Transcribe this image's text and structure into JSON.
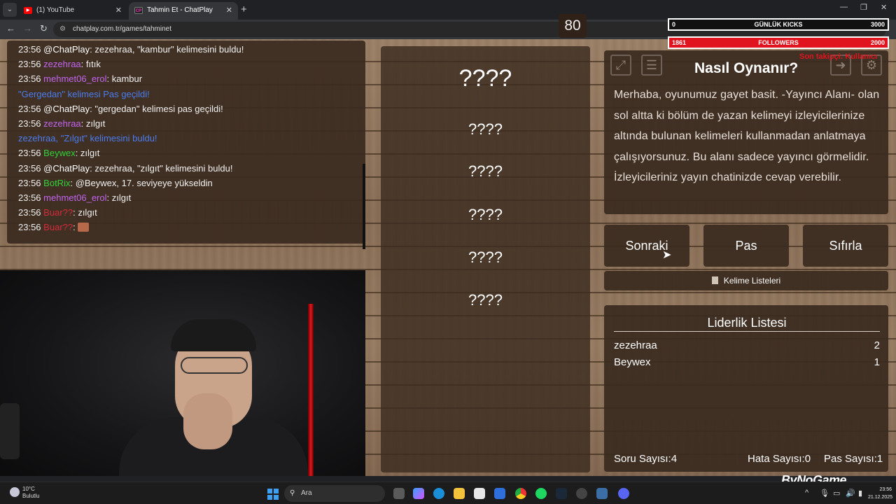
{
  "browser": {
    "tabs": [
      {
        "title": "(1) YouTube",
        "favicon": "youtube-icon",
        "active": false
      },
      {
        "title": "Tahmin Et - ChatPlay",
        "favicon": "chatplay-icon",
        "active": true
      }
    ],
    "url": "chatplay.com.tr/games/tahminet",
    "new_tab_glyph": "+",
    "close_glyph": "✕"
  },
  "chat": {
    "messages": [
      {
        "time": "23:56",
        "user": "@ChatPlay",
        "user_color": "white",
        "text": ": zezehraa, \"kambur\" kelimesini buldu!"
      },
      {
        "time": "23:56",
        "user": "zezehraa",
        "user_color": "purple",
        "text": ": fıtık"
      },
      {
        "time": "23:56",
        "user": "mehmet06_erol",
        "user_color": "purple",
        "text": ": kambur"
      },
      {
        "time": "",
        "user": "",
        "user_color": "system",
        "text": "\"Gergedan\" kelimesi Pas geçildi!"
      },
      {
        "time": "23:56",
        "user": "@ChatPlay",
        "user_color": "white",
        "text": ": \"gergedan\" kelimesi pas geçildi!"
      },
      {
        "time": "23:56",
        "user": "zezehraa",
        "user_color": "purple",
        "text": ": zılgıt"
      },
      {
        "time": "",
        "user": "",
        "user_color": "system",
        "text": "zezehraa, \"Zılgıt\" kelimesini buldu!"
      },
      {
        "time": "23:56",
        "user": "Beywex",
        "user_color": "green",
        "text": ": zılgıt"
      },
      {
        "time": "23:56",
        "user": "@ChatPlay",
        "user_color": "white",
        "text": ": zezehraa, \"zılgıt\" kelimesini buldu!"
      },
      {
        "time": "23:56",
        "user": "BotRix",
        "user_color": "green",
        "text": ": @Beywex, 17. seviyeye yükseldin"
      },
      {
        "time": "23:56",
        "user": "mehmet06_erol",
        "user_color": "purple",
        "text": ": zılgıt"
      },
      {
        "time": "23:56",
        "user": "Buar??",
        "user_color": "red",
        "text": ": zılgıt"
      },
      {
        "time": "23:56",
        "user": "Buar??",
        "user_color": "red",
        "text": ": ",
        "emote": true
      }
    ]
  },
  "game": {
    "timer": "80",
    "current_word": "????",
    "hidden_words": [
      "????",
      "????",
      "????",
      "????",
      "????"
    ],
    "howto": {
      "title": "Nasıl Oynanır?",
      "text": "Merhaba, oyunumuz gayet basit. -Yayıncı Alanı- olan sol altta ki bölüm de yazan kelimeyi izleyicilerinize altında bulunan kelimeleri kullanmadan anlatmaya çalışıyorsunuz. Bu alanı sadece yayıncı görmelidir. İzleyicileriniz yayın chatinizde cevap verebilir."
    },
    "buttons": {
      "next": "Sonraki",
      "pass": "Pas",
      "reset": "Sıfırla",
      "word_lists": "Kelime Listeleri"
    },
    "leaderboard": {
      "title": "Liderlik Listesi",
      "rows": [
        {
          "name": "zezehraa",
          "score": "2"
        },
        {
          "name": "Beywex",
          "score": "1"
        }
      ]
    },
    "stats": {
      "questions_label": "Soru Sayısı:",
      "questions": "4",
      "errors_label": "Hata Sayısı:",
      "errors": "0",
      "passes_label": "Pas Sayısı:",
      "passes": "1"
    }
  },
  "overlay": {
    "kicks": {
      "current": "0",
      "label": "GÜNLÜK KICKS",
      "goal": "3000",
      "progress": 0
    },
    "followers": {
      "current": "1861",
      "label": "FOLLOWERS",
      "goal": "2000",
      "progress": 0.93
    },
    "red_text": "Son takipçi: Kullanıcı",
    "brand": "ByNoGame"
  },
  "taskbar": {
    "weather_temp": "10°C",
    "weather_desc": "Bulutlu",
    "search_placeholder": "Ara",
    "time": "23:56",
    "date": "21.12.2025"
  },
  "colors": {
    "accent_red": "#e0141e",
    "panel": "#3a2a1e",
    "chat_purple": "#c264f0",
    "chat_green": "#32d23a"
  }
}
